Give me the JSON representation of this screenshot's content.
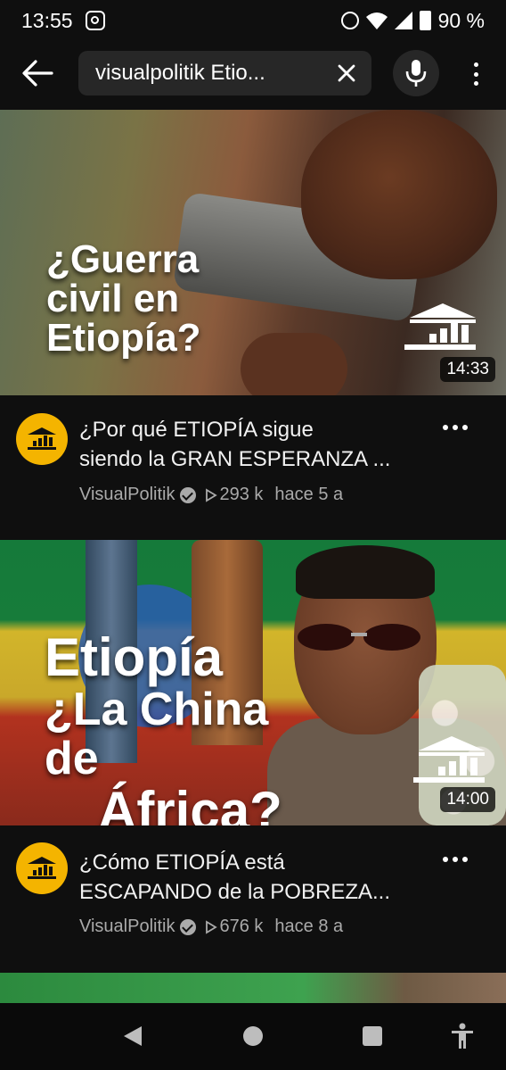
{
  "status_bar": {
    "time": "13:55",
    "battery": "90 %"
  },
  "search": {
    "query": "visualpolitik Etio..."
  },
  "videos": [
    {
      "thumbnail_text": [
        "¿Guerra",
        "civil en",
        "Etiopía?"
      ],
      "duration": "14:33",
      "title": "¿Por qué ETIOPÍA sigue siendo la GRAN ESPERANZA ...",
      "title_lines": [
        "¿Por qué ETIOPÍA sigue",
        "siendo la GRAN ESPERANZA ..."
      ],
      "channel": "VisualPolitik",
      "views": "293 k",
      "age": "hace 5 a"
    },
    {
      "thumbnail_text": [
        "Etiopía",
        "¿La China de",
        "África?"
      ],
      "duration": "14:00",
      "title": "¿Cómo ETIOPÍA está ESCAPANDO de la POBREZA...",
      "title_lines": [
        "¿Cómo ETIOPÍA  está",
        "ESCAPANDO  de la POBREZA..."
      ],
      "channel": "VisualPolitik",
      "views": "676 k",
      "age": "hace 8 a"
    }
  ],
  "colors": {
    "background": "#0f0f0f",
    "avatar": "#f4b400",
    "meta_text": "#aaaaaa",
    "search_box": "#272727"
  }
}
